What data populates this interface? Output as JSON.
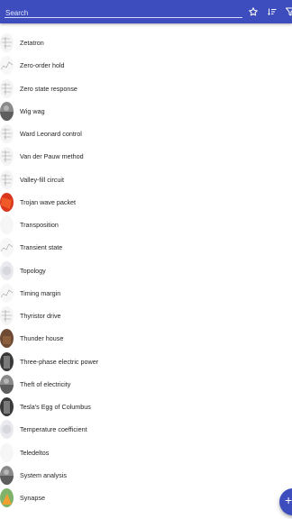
{
  "search": {
    "placeholder": "Search",
    "value": ""
  },
  "toolbar": {
    "accent_color": "#3d4dbd",
    "icons": [
      "star-outline-icon",
      "sort-icon",
      "filter-icon"
    ]
  },
  "list": {
    "items": [
      {
        "label": "Zetatron",
        "thumb": "schematic"
      },
      {
        "label": "Zero-order hold",
        "thumb": "graph"
      },
      {
        "label": "Zero state response",
        "thumb": "schematic"
      },
      {
        "label": "Wig wag",
        "thumb": "photo-gray"
      },
      {
        "label": "Ward Leonard control",
        "thumb": "schematic"
      },
      {
        "label": "Van der Pauw method",
        "thumb": "schematic"
      },
      {
        "label": "Valley-fill circuit",
        "thumb": "schematic"
      },
      {
        "label": "Trojan wave packet",
        "thumb": "photo-red"
      },
      {
        "label": "Transposition",
        "thumb": "blank"
      },
      {
        "label": "Transient state",
        "thumb": "graph"
      },
      {
        "label": "Topology",
        "thumb": "light"
      },
      {
        "label": "Timing margin",
        "thumb": "graph"
      },
      {
        "label": "Thyristor drive",
        "thumb": "schematic"
      },
      {
        "label": "Thunder house",
        "thumb": "photo-brown"
      },
      {
        "label": "Three-phase electric power",
        "thumb": "photo-dark"
      },
      {
        "label": "Theft of electricity",
        "thumb": "photo-gray"
      },
      {
        "label": "Tesla's Egg of Columbus",
        "thumb": "photo-dark"
      },
      {
        "label": "Temperature coefficient",
        "thumb": "light"
      },
      {
        "label": "Teledeltos",
        "thumb": "blank"
      },
      {
        "label": "System analysis",
        "thumb": "photo-gray"
      },
      {
        "label": "Synapse",
        "thumb": "photo-color"
      }
    ]
  },
  "fab": {
    "icon": "add-icon",
    "symbol": "+"
  }
}
